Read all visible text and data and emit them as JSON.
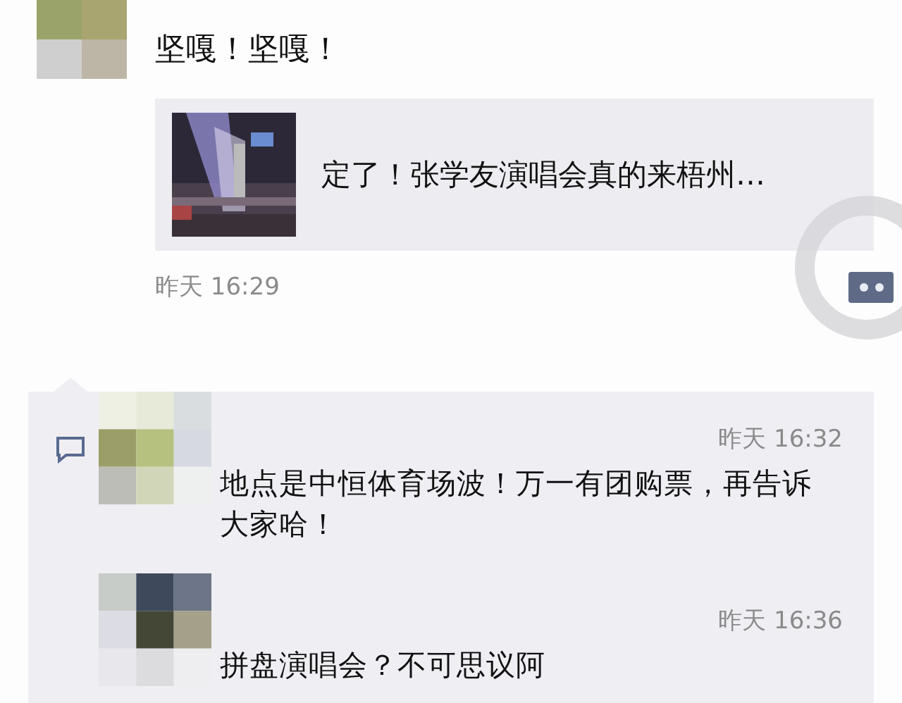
{
  "post": {
    "text": "坚嘎！坚嘎！",
    "link": {
      "title": "定了！张学友演唱会真的来梧州…"
    },
    "time": "昨天 16:29"
  },
  "comments": [
    {
      "time": "昨天 16:32",
      "text": "地点是中恒体育场波！万一有团购票，再告诉大家哈！"
    },
    {
      "time": "昨天 16:36",
      "text": "拼盘演唱会？不可思议阿"
    }
  ]
}
